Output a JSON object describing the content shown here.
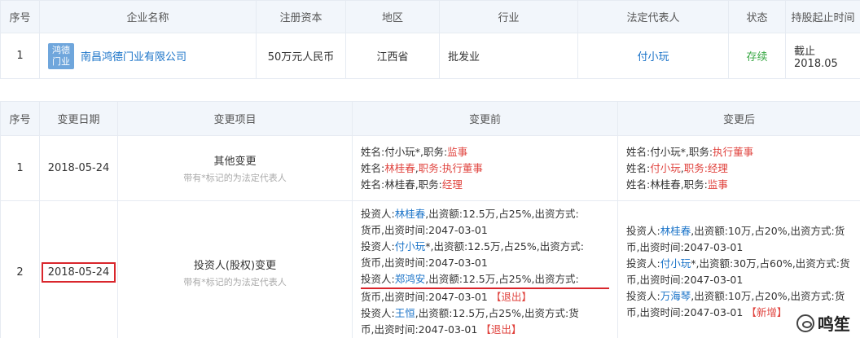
{
  "company_table": {
    "headers": [
      "序号",
      "企业名称",
      "注册资本",
      "地区",
      "行业",
      "法定代表人",
      "状态",
      "持股起止时间"
    ],
    "row": {
      "index": "1",
      "logo_text": "鸿德门业",
      "name": "南昌鸿德门业有限公司",
      "capital": "50万元人民币",
      "region": "江西省",
      "industry": "批发业",
      "legal_rep": "付小玩",
      "status": "存续",
      "period": "截止 2018.05"
    }
  },
  "change_table": {
    "headers": [
      "序号",
      "变更日期",
      "变更项目",
      "变更前",
      "变更后"
    ],
    "rows": [
      {
        "index": "1",
        "date": "2018-05-24",
        "item": "其他变更",
        "note": "带有*标记的为法定代表人",
        "before": [
          [
            {
              "t": "姓名:"
            },
            {
              "t": "付小玩*",
              "c": "n"
            },
            {
              "t": ",职务:"
            },
            {
              "t": "监事",
              "c": "red"
            }
          ],
          [
            {
              "t": "姓名:"
            },
            {
              "t": "林桂春",
              "c": "red"
            },
            {
              "t": ","
            },
            {
              "t": "职务:执行董事",
              "c": "red"
            }
          ],
          [
            {
              "t": "姓名:林桂春,职务:"
            },
            {
              "t": "经理",
              "c": "red"
            }
          ]
        ],
        "after": [
          [
            {
              "t": "姓名:付小玩*,职务:"
            },
            {
              "t": "执行董事",
              "c": "red"
            }
          ],
          [
            {
              "t": "姓名:"
            },
            {
              "t": "付小玩",
              "c": "red"
            },
            {
              "t": ","
            },
            {
              "t": "职务:经理",
              "c": "red"
            }
          ],
          [
            {
              "t": "姓名:林桂春,职务:"
            },
            {
              "t": "监事",
              "c": "red"
            }
          ]
        ]
      },
      {
        "index": "2",
        "date": "2018-05-24",
        "item": "投资人(股权)变更",
        "note": "带有*标记的为法定代表人",
        "before": [
          [
            {
              "t": "投资人:"
            },
            {
              "t": "林桂春",
              "c": "blue"
            },
            {
              "t": ",出资额:12.5万,占25%,出资方式:"
            }
          ],
          [
            {
              "t": "货币,出资时间:2047-03-01"
            }
          ],
          [
            {
              "t": "投资人:"
            },
            {
              "t": "付小玩",
              "c": "blue"
            },
            {
              "t": "*,出资额:12.5万,占25%,出资方式:"
            }
          ],
          [
            {
              "t": "货币,出资时间:2047-03-01"
            }
          ],
          [
            {
              "t": "投资人:"
            },
            {
              "t": "郑鸿安",
              "c": "blue"
            },
            {
              "t": ",出资额:12.5万,占25%,出资方式:"
            }
          ],
          [
            {
              "t": "货币,出资时间:2047-03-01 "
            },
            {
              "t": "【退出】",
              "c": "red"
            }
          ],
          [
            {
              "t": "投资人:"
            },
            {
              "t": "王恒",
              "c": "blue"
            },
            {
              "t": ",出资额:12.5万,占25%,出资方式:货"
            }
          ],
          [
            {
              "t": "币,出资时间:2047-03-01 "
            },
            {
              "t": "【退出】",
              "c": "red"
            }
          ]
        ],
        "after": [
          [
            {
              "t": "投资人:"
            },
            {
              "t": "林桂春",
              "c": "blue"
            },
            {
              "t": ",出资额:10万,占20%,出资方式:货"
            }
          ],
          [
            {
              "t": "币,出资时间:2047-03-01"
            }
          ],
          [
            {
              "t": "投资人:"
            },
            {
              "t": "付小玩",
              "c": "blue"
            },
            {
              "t": "*,出资额:30万,占60%,出资方式:货"
            }
          ],
          [
            {
              "t": "币,出资时间:2047-03-01"
            }
          ],
          [
            {
              "t": "投资人:"
            },
            {
              "t": "万海琴",
              "c": "blue"
            },
            {
              "t": ",出资额:10万,占20%,出资方式:货"
            }
          ],
          [
            {
              "t": "币,出资时间:2047-03-01 "
            },
            {
              "t": "【新增】",
              "c": "red"
            }
          ]
        ]
      }
    ]
  },
  "watermark": "鸣笙"
}
